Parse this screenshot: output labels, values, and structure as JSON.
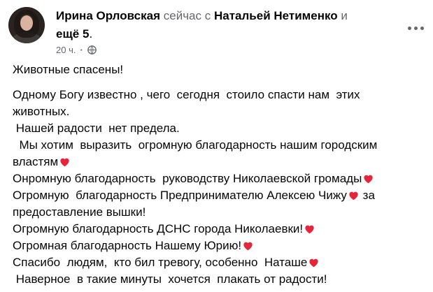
{
  "post": {
    "author": "Ирина Орловская",
    "with_text": "сейчас с",
    "tagged": "Натальей Нетименко",
    "and_text": "и",
    "others": "ещё 5",
    "time": "20 ч.",
    "privacy_icon": "globe-icon",
    "more_icon": "more-icon",
    "lines": [
      "Животные спасены!",
      "Одному Богу известно , чего  сегодня  стоило спасти нам  этих",
      "животных.",
      " Нашей радости  нет предела.",
      "  Мы хотим  выразить  огромную благодарность нашим городским",
      "властям",
      "Онромную благодарность  руководству Николаевской громады",
      "Огромную  благодарность Предпринимателю Алексею Чижу",
      " за",
      "предоставление вышки!",
      "Огромную благодарность ДСНС города Николаевки!",
      "Огромная благодарность Нашему Юрию!",
      "Спасибо  людям,  кто бил тревогу, особенно  Наташе",
      " Наверное  в такие минуты  хочется  плакать от радости!"
    ],
    "heart_color": "#e8243b"
  }
}
